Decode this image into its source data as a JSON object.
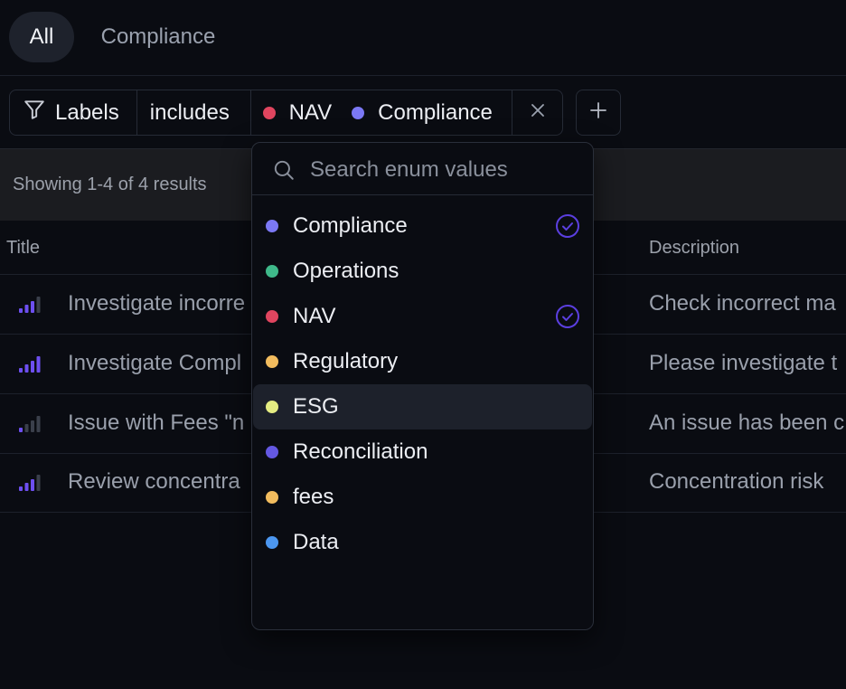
{
  "tabs": [
    {
      "label": "All",
      "active": true
    },
    {
      "label": "Compliance",
      "active": false
    }
  ],
  "filter": {
    "field_label": "Labels",
    "operator": "includes",
    "values": [
      {
        "label": "NAV",
        "color": "#e0455f"
      },
      {
        "label": "Compliance",
        "color": "#7b78f4"
      }
    ]
  },
  "results": {
    "text": "Showing 1-4 of 4 results"
  },
  "table": {
    "columns": {
      "title": "Title",
      "description": "Description"
    },
    "rows": [
      {
        "title": "Investigate incorre",
        "description": "Check incorrect ma",
        "priority": "medium"
      },
      {
        "title": "Investigate Compl",
        "description": "Please investigate t",
        "priority": "high"
      },
      {
        "title": "Issue with Fees \"n",
        "description": "An issue has been c",
        "priority": "low"
      },
      {
        "title": "Review concentra",
        "description": "Concentration risk",
        "priority": "medium"
      }
    ]
  },
  "dropdown": {
    "search_placeholder": "Search enum values",
    "options": [
      {
        "label": "Compliance",
        "color": "#7b78f4",
        "selected": true,
        "highlighted": false
      },
      {
        "label": "Operations",
        "color": "#3fb98a",
        "selected": false,
        "highlighted": false
      },
      {
        "label": "NAV",
        "color": "#e0455f",
        "selected": true,
        "highlighted": false
      },
      {
        "label": "Regulatory",
        "color": "#f2bc5e",
        "selected": false,
        "highlighted": false
      },
      {
        "label": "ESG",
        "color": "#e4ec82",
        "selected": false,
        "highlighted": true
      },
      {
        "label": "Reconciliation",
        "color": "#6458e2",
        "selected": false,
        "highlighted": false
      },
      {
        "label": "fees",
        "color": "#f2bc5e",
        "selected": false,
        "highlighted": false
      },
      {
        "label": "Data",
        "color": "#4c97f0",
        "selected": false,
        "highlighted": false
      }
    ]
  },
  "colors": {
    "accent": "#6d4ff0",
    "background": "#0a0c12",
    "check": "#5b3fe0"
  },
  "icons": {
    "filter": "filter-icon",
    "clear": "close-icon",
    "add": "plus-icon",
    "search": "search-icon",
    "check": "check-circle-icon",
    "priority": "signal-bars-icon"
  }
}
